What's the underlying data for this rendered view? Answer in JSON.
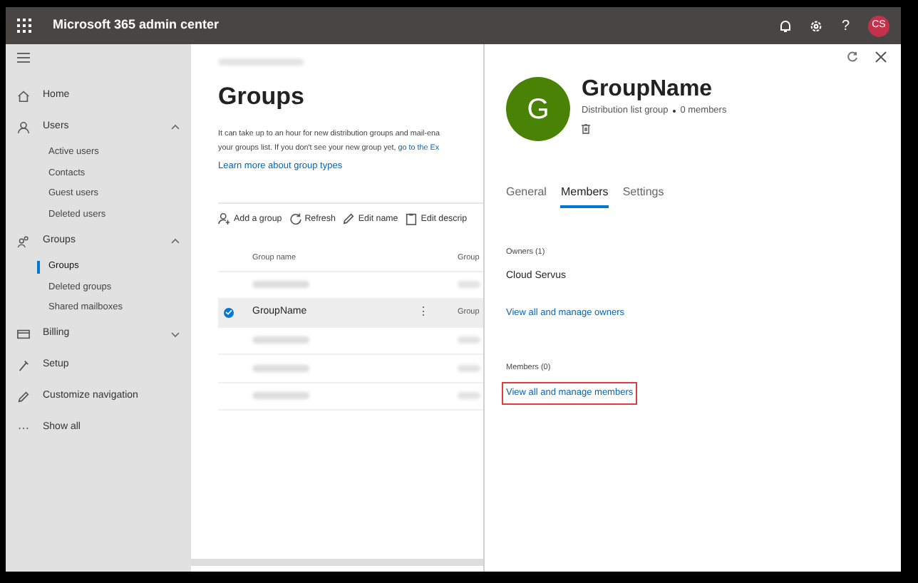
{
  "top_bar": {
    "title": "Microsoft 365 admin center",
    "avatar_initials": "CS",
    "help_glyph": "?"
  },
  "sidebar": {
    "items": [
      {
        "label": "Home"
      },
      {
        "label": "Users",
        "expanded": true,
        "children": [
          {
            "label": "Active users",
            "selected": false
          },
          {
            "label": "Contacts",
            "selected": false
          },
          {
            "label": "Guest users",
            "selected": false
          },
          {
            "label": "Deleted users",
            "selected": false
          }
        ]
      },
      {
        "label": "Groups",
        "expanded": true,
        "children": [
          {
            "label": "Groups",
            "selected": true
          },
          {
            "label": "Deleted groups",
            "selected": false
          },
          {
            "label": "Shared mailboxes",
            "selected": false
          }
        ]
      },
      {
        "label": "Billing",
        "expanded": false
      },
      {
        "label": "Setup"
      },
      {
        "label": "Customize navigation"
      },
      {
        "label": "Show all"
      }
    ]
  },
  "main": {
    "title": "Groups",
    "description": [
      "It can take up to an hour for new distribution groups and mail-ena",
      "your groups list. If you don't see your new group yet,"
    ],
    "description_link": "go to the Ex",
    "learn_more": "Learn more about group types",
    "toolbar": [
      {
        "label": "Add a group"
      },
      {
        "label": "Refresh"
      },
      {
        "label": "Edit name"
      },
      {
        "label": "Edit descrip"
      }
    ],
    "table": {
      "columns": [
        "Group name",
        "Group"
      ],
      "rows": [
        {
          "kind": "redacted",
          "selected": false
        },
        {
          "kind": "named",
          "name": "GroupName",
          "menu_glyph": "⋮",
          "column_2": "Group",
          "selected": true
        },
        {
          "kind": "redacted",
          "selected": false
        },
        {
          "kind": "redacted",
          "selected": false
        },
        {
          "kind": "redacted",
          "selected": false
        }
      ]
    }
  },
  "panel": {
    "avatar_letter": "G",
    "title": "GroupName",
    "subtitle": "Distribution list group",
    "member_count": "0 members",
    "tabs": [
      {
        "label": "General",
        "selected": false
      },
      {
        "label": "Members",
        "selected": true
      },
      {
        "label": "Settings",
        "selected": false
      }
    ],
    "owners_heading": "Owners (1)",
    "owner": "Cloud Servus",
    "owners_link": "View all and manage owners",
    "members_heading": "Members (0)",
    "members_link": "View all and manage members",
    "members_link_highlighted": true
  }
}
